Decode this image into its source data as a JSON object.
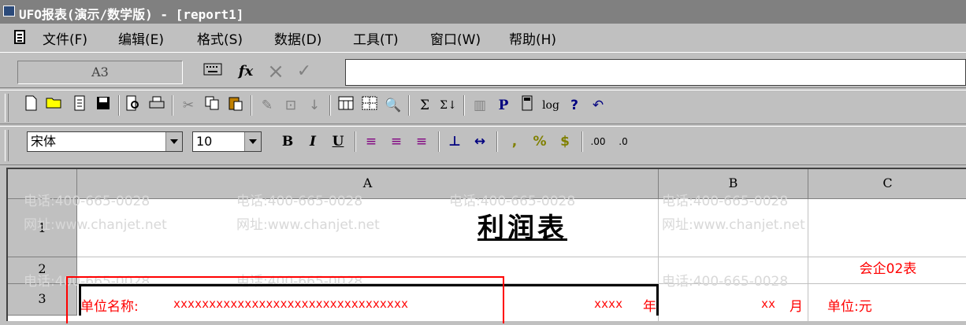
{
  "window": {
    "title": "UFO报表(演示/数学版) - [report1]"
  },
  "menu": {
    "items": [
      "文件(F)",
      "编辑(E)",
      "格式(S)",
      "数据(D)",
      "工具(T)",
      "窗口(W)",
      "帮助(H)"
    ]
  },
  "formula_bar": {
    "cell_ref": "A3",
    "fx_label": "fx",
    "cancel_label": "×",
    "accept_label": "✓",
    "formula": ""
  },
  "format_bar": {
    "font": "宋体",
    "size": "10",
    "bold": "B",
    "italic": "I",
    "underline": "U",
    "comma": ",",
    "percent": "%",
    "currency": "$",
    "inc_decimal": ".00",
    "dec_decimal": ".0"
  },
  "toolbar": {
    "sigma": "Σ",
    "sigma2": "Σ↓",
    "p": "P",
    "log": "log",
    "help": "?"
  },
  "sheet": {
    "columns": [
      "A",
      "B",
      "C"
    ],
    "rows": [
      "1",
      "2",
      "3"
    ],
    "title": "利润表",
    "form_code": "会企02表",
    "unit_label": "单位名称:",
    "unit_value": "xxxxxxxxxxxxxxxxxxxxxxxxxxxxxxxxx",
    "year_value": "xxxx",
    "year_label": "年",
    "month_value": "xx",
    "month_label": "月",
    "currency_unit": "单位:元"
  },
  "watermark": {
    "phone": "电话:400-665-0028",
    "site": "网址:www.chanjet.net"
  },
  "colors": {
    "title_bar": "#808080",
    "highlight_box": "#ff0000",
    "red_text": "#ff0000"
  }
}
